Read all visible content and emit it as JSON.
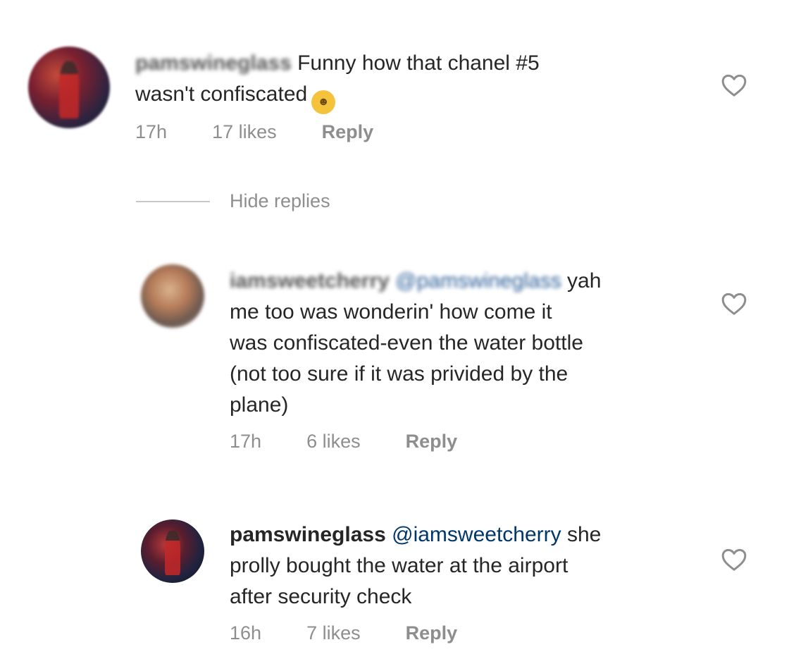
{
  "comments": [
    {
      "username": "pamswineglass",
      "text_line1": "Funny how that chanel #5",
      "text_line2": "wasn't confiscated",
      "emoji": "smiling-face-emoji",
      "time": "17h",
      "likes": "17 likes",
      "reply": "Reply"
    }
  ],
  "hide_replies": "Hide replies",
  "replies": [
    {
      "username": "iamsweetcherry",
      "mention": "@pamswineglass",
      "text_line1_tail": "yah",
      "text_lines": [
        "me too was wonderin' how come it",
        "was confiscated-even the water bottle",
        "(not too sure if it was privided by the",
        "plane)"
      ],
      "time": "17h",
      "likes": "6 likes",
      "reply": "Reply"
    },
    {
      "username": "pamswineglass",
      "mention": "@iamsweetcherry",
      "text_line1_tail": "she",
      "text_lines": [
        "prolly bought the water at the airport",
        "after security check"
      ],
      "time": "16h",
      "likes": "7 likes",
      "reply": "Reply"
    }
  ],
  "icons": {
    "like": "heart-outline-icon"
  },
  "colors": {
    "text": "#262626",
    "meta": "#8e8e8e",
    "mention": "#00376b"
  }
}
